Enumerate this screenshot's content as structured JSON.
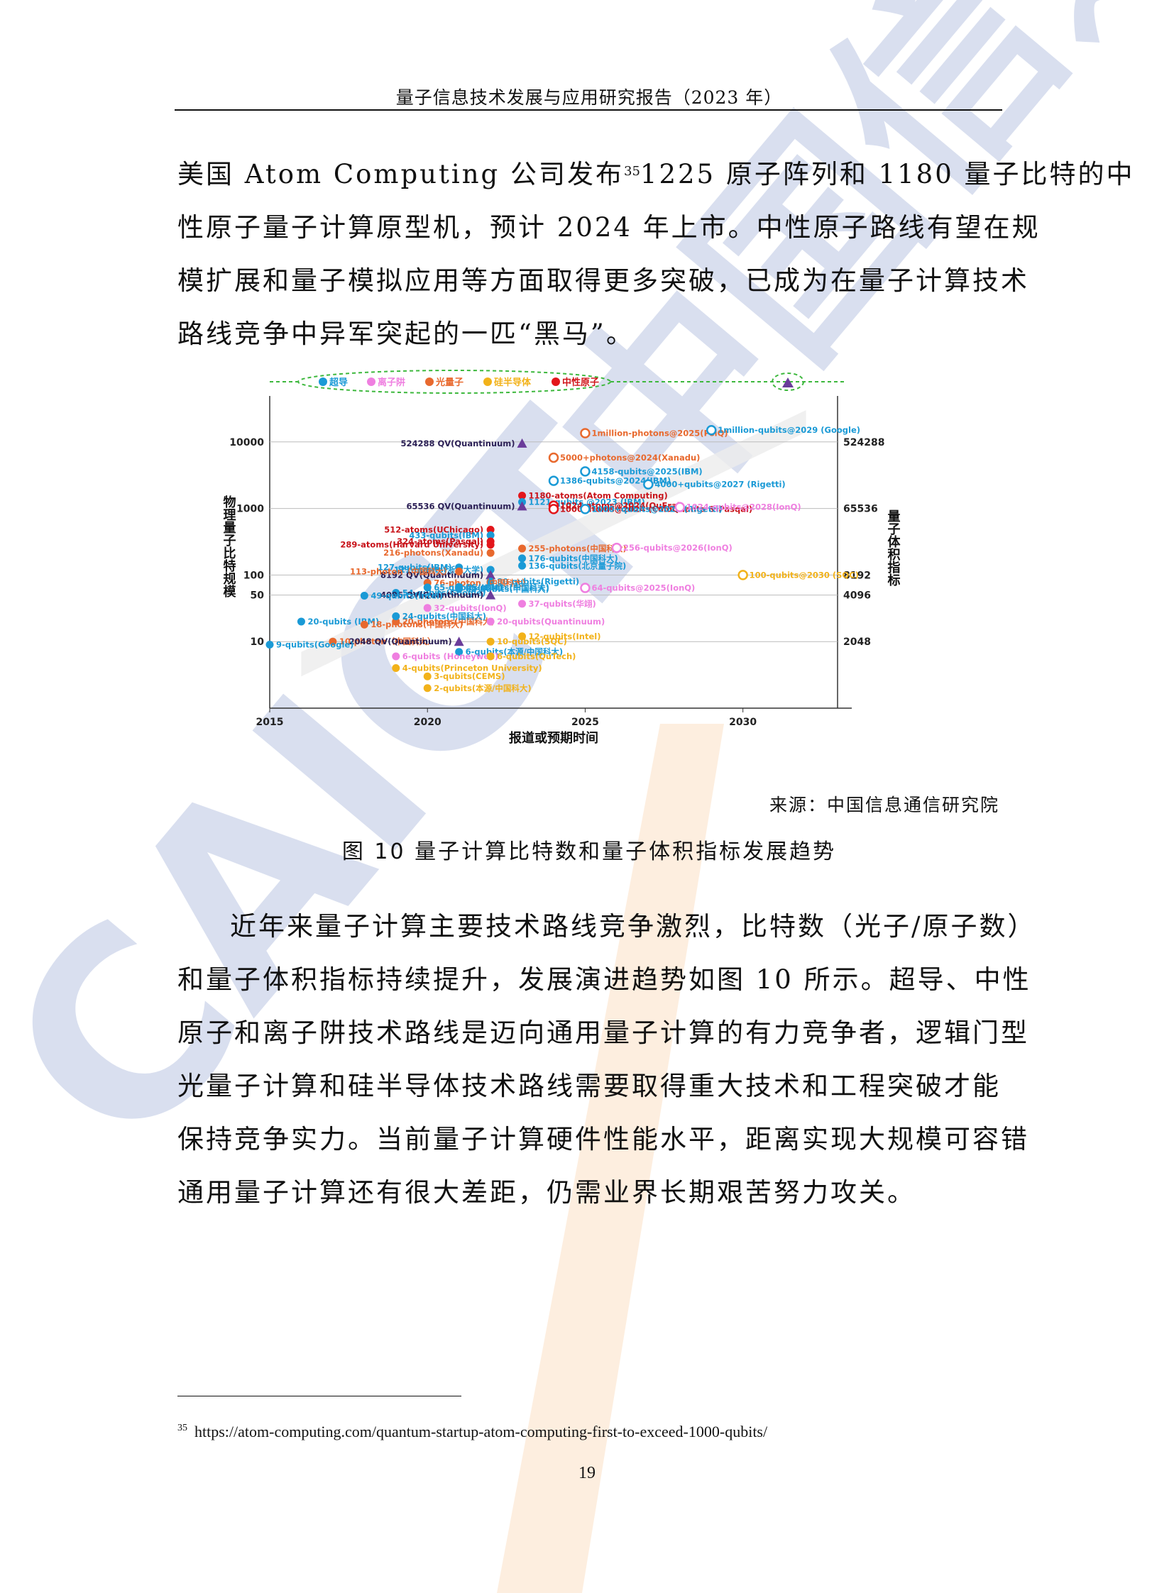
{
  "header": {
    "running_title": "量子信息技术发展与应用研究报告（2023 年）"
  },
  "paragraph1": {
    "lines": [
      "美国 Atom Computing 公司发布",
      "性原子量子计算原型机，预计 2024 年上市。中性原子路线有望在规",
      "模扩展和量子模拟应用等方面取得更多突破，已成为在量子计算技术",
      "路线竞争中异军突起的一匹“黑马”。"
    ],
    "footnote_ref": "35",
    "line1_tail": "1225 原子阵列和 1180 量子比特的中"
  },
  "figure": {
    "source": "来源：中国信息通信研究院",
    "caption": "图 10  量子计算比特数和量子体积指标发展趋势"
  },
  "chart_data": {
    "type": "scatter",
    "xlabel": "报道或预期时间",
    "ylabel": "物理量子比特规模",
    "y2label": "量子体积指标",
    "x_ticks": [
      "2015",
      "2020",
      "2025",
      "2030"
    ],
    "y_ticks": [
      "10000",
      "1000",
      "100",
      "50",
      "10"
    ],
    "y2_ticks": [
      "524288",
      "65536",
      "8192",
      "4096",
      "2048"
    ],
    "colors": {
      "superconducting": "#1a9ad6",
      "ion_trap": "#ef7fe0",
      "photonic": "#e8692e",
      "silicon": "#f2b21a",
      "neutral_atom": "#e3161b",
      "quantum_volume": "#6a3c9a"
    },
    "legend": [
      {
        "label": "超导",
        "color": "#1a9ad6"
      },
      {
        "label": "离子阱",
        "color": "#ef7fe0"
      },
      {
        "label": "光量子",
        "color": "#e8692e"
      },
      {
        "label": "硅半导体",
        "color": "#f2b21a"
      },
      {
        "label": "中性原子",
        "color": "#e3161b"
      }
    ],
    "points": [
      {
        "label": "1million-photons@2025(PsiQ)",
        "x": 2025.0,
        "y": 13500,
        "series": "photonic",
        "projected": true
      },
      {
        "label": "524288 QV(Quantinuum)",
        "x": 2023.0,
        "y": 9500,
        "series": "quantum_volume",
        "marker": "triangle"
      },
      {
        "label": "5000+photons@2024(Xanadu)",
        "x": 2024.0,
        "y": 5800,
        "series": "photonic",
        "projected": true
      },
      {
        "label": "4158-qubits@2025(IBM)",
        "x": 2025.0,
        "y": 3600,
        "series": "superconducting",
        "projected": true
      },
      {
        "label": "1386-qubits@2024(IBM)",
        "x": 2024.0,
        "y": 2600,
        "series": "superconducting",
        "projected": true
      },
      {
        "label": "1180-atoms(Atom Computing)",
        "x": 2023.0,
        "y": 1560,
        "series": "neutral_atom"
      },
      {
        "label": "1121-qubits @2023 (IBM)",
        "x": 2023.0,
        "y": 1250,
        "series": "superconducting"
      },
      {
        "label": "65536 QV(Quantinuum)",
        "x": 2023.0,
        "y": 1080,
        "series": "quantum_volume",
        "marker": "triangle"
      },
      {
        "label": "1024-atoms@2024(QuEra)",
        "x": 2024.0,
        "y": 1100,
        "series": "neutral_atom",
        "projected": true
      },
      {
        "label": "1000-atoms@2024 (ColdQuanta & Pasqal)",
        "x": 2024.0,
        "y": 980,
        "series": "neutral_atom",
        "projected": true
      },
      {
        "label": "1000+qubits@2025 (Rigetti)",
        "x": 2025.0,
        "y": 980,
        "series": "superconducting",
        "projected": true
      },
      {
        "label": "4000+qubits@2027 (Rigetti)",
        "x": 2027.0,
        "y": 2300,
        "series": "superconducting",
        "projected": true
      },
      {
        "label": "1024-qubits@2028(IonQ)",
        "x": 2028.0,
        "y": 1050,
        "series": "ion_trap",
        "projected": true
      },
      {
        "label": "1million-qubits@2029 (Google)",
        "x": 2029.0,
        "y": 15000,
        "series": "superconducting",
        "projected": true
      },
      {
        "label": "512-atoms(UChicago)",
        "x": 2022.0,
        "y": 480,
        "series": "neutral_atom"
      },
      {
        "label": "433-qubits(IBM)",
        "x": 2022.0,
        "y": 395,
        "series": "superconducting"
      },
      {
        "label": "324-atoms(Pasqal)",
        "x": 2022.0,
        "y": 320,
        "series": "neutral_atom"
      },
      {
        "label": "289-atoms(Harvard University)",
        "x": 2022.0,
        "y": 285,
        "series": "neutral_atom"
      },
      {
        "label": "255-photons(中国科大)",
        "x": 2023.0,
        "y": 250,
        "series": "photonic"
      },
      {
        "label": "216-photons(Xanadu)",
        "x": 2022.0,
        "y": 215,
        "series": "photonic"
      },
      {
        "label": "127-qubits(IBM)",
        "x": 2021.0,
        "y": 130,
        "series": "superconducting"
      },
      {
        "label": "176-qubits(中国科大)",
        "x": 2023.0,
        "y": 178,
        "series": "superconducting"
      },
      {
        "label": "136-qubits(北京量子院)",
        "x": 2023.0,
        "y": 138,
        "series": "superconducting"
      },
      {
        "label": "121-qubits(浙江大学)",
        "x": 2022.0,
        "y": 120,
        "series": "superconducting"
      },
      {
        "label": "8192 QV(Quantinuum)",
        "x": 2022.0,
        "y": 100,
        "series": "quantum_volume",
        "marker": "triangle"
      },
      {
        "label": "256-qubits@2026(IonQ)",
        "x": 2026.0,
        "y": 256,
        "series": "ion_trap",
        "projected": true
      },
      {
        "label": "113-photon（中国科大）",
        "x": 2021.0,
        "y": 113,
        "series": "photonic"
      },
      {
        "label": "100-qubits@2030 (SQC)",
        "x": 2030.0,
        "y": 100,
        "series": "silicon",
        "projected": true
      },
      {
        "label": "80-qubits(Rigetti)",
        "x": 2022.0,
        "y": 80,
        "series": "superconducting"
      },
      {
        "label": "76-photon（中国科大）",
        "x": 2020.0,
        "y": 76,
        "series": "photonic"
      },
      {
        "label": "66-qubits(中国科大)",
        "x": 2021.0,
        "y": 66,
        "series": "superconducting"
      },
      {
        "label": "62-qubits(中国科大)",
        "x": 2021.0,
        "y": 62,
        "series": "superconducting"
      },
      {
        "label": "65-qubits(IBM)",
        "x": 2020.0,
        "y": 65,
        "series": "superconducting"
      },
      {
        "label": "54-qubits(Google)",
        "x": 2019.0,
        "y": 54,
        "series": "superconducting"
      },
      {
        "label": "64-qubits@2025(IonQ)",
        "x": 2025.0,
        "y": 64,
        "series": "ion_trap",
        "projected": true
      },
      {
        "label": "4096 QV(Quantinuum)",
        "x": 2022.0,
        "y": 50,
        "series": "quantum_volume",
        "marker": "triangle"
      },
      {
        "label": "49-qubits(Intel)",
        "x": 2018.0,
        "y": 49,
        "series": "superconducting"
      },
      {
        "label": "32-qubits(IonQ)",
        "x": 2020.0,
        "y": 32,
        "series": "ion_trap"
      },
      {
        "label": "37-qubits(华翊)",
        "x": 2023.0,
        "y": 37,
        "series": "ion_trap"
      },
      {
        "label": "20-photons(中国科大)",
        "x": 2019.0,
        "y": 20,
        "series": "photonic"
      },
      {
        "label": "24-qubits(中国科大)",
        "x": 2019.0,
        "y": 24,
        "series": "superconducting"
      },
      {
        "label": "20-qubits (IBM)",
        "x": 2016.0,
        "y": 20,
        "series": "superconducting"
      },
      {
        "label": "20-qubits(Quantinuum)",
        "x": 2022.0,
        "y": 20,
        "series": "ion_trap"
      },
      {
        "label": "18-photons(中国科大)",
        "x": 2018.0,
        "y": 18,
        "series": "photonic"
      },
      {
        "label": "12-qubits(Intel)",
        "x": 2023.0,
        "y": 12,
        "series": "silicon"
      },
      {
        "label": "10-photon（中国科大）",
        "x": 2017.0,
        "y": 10,
        "series": "photonic"
      },
      {
        "label": "2048 QV(Quantinuum)",
        "x": 2021.0,
        "y": 10,
        "series": "quantum_volume",
        "marker": "triangle"
      },
      {
        "label": "10-qubits(SQC)",
        "x": 2022.0,
        "y": 10,
        "series": "silicon"
      },
      {
        "label": "9-qubits(Google)",
        "x": 2015.0,
        "y": 9,
        "series": "superconducting"
      },
      {
        "label": "6-qubits(本源/中国科大)",
        "x": 2021.0,
        "y": 7,
        "series": "superconducting"
      },
      {
        "label": "6-qubits (Honeywell)",
        "x": 2019.0,
        "y": 6,
        "series": "ion_trap"
      },
      {
        "label": "6-qubits(QuTech)",
        "x": 2022.0,
        "y": 6,
        "series": "silicon"
      },
      {
        "label": "4-qubits(Princeton University)",
        "x": 2019.0,
        "y": 4,
        "series": "silicon"
      },
      {
        "label": "3-qubits(CEMS)",
        "x": 2020.0,
        "y": 3,
        "series": "silicon"
      },
      {
        "label": "2-qubits(本源/中国科大)",
        "x": 2020.0,
        "y": 2,
        "series": "silicon"
      }
    ]
  },
  "paragraph2": {
    "lines": [
      "近年来量子计算主要技术路线竞争激烈，比特数（光子/原子数）",
      "和量子体积指标持续提升，发展演进趋势如图 10 所示。超导、中性",
      "原子和离子阱技术路线是迈向通用量子计算的有力竞争者，逻辑门型",
      "光量子计算和硅半导体技术路线需要取得重大技术和工程突破才能",
      "保持竞争实力。当前量子计算硬件性能水平，距离实现大规模可容错",
      "通用量子计算还有很大差距，仍需业界长期艰苦努力攻关。"
    ]
  },
  "footnote": {
    "marker": "35",
    "text": "https://atom-computing.com/quantum-startup-atom-computing-first-to-exceed-1000-qubits/"
  },
  "page_number": "19",
  "watermark": {
    "text": "CAICT中国信通院",
    "color_blue": "#3355a8",
    "color_orange": "#f08c2a"
  }
}
